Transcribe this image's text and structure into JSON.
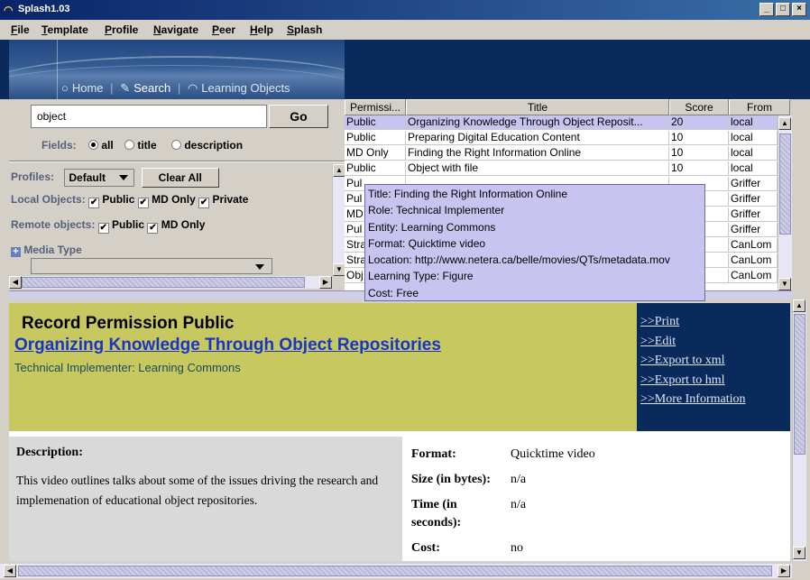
{
  "window": {
    "title": "Splash1.03",
    "minimize": "_",
    "maximize": "□",
    "close": "×"
  },
  "menu": [
    "File",
    "Template",
    "Profile",
    "Navigate",
    "Peer",
    "Help",
    "Splash"
  ],
  "nav": {
    "home": "Home",
    "search": "Search",
    "learning": "Learning Objects",
    "sep": "|"
  },
  "search": {
    "value": "object",
    "go": "Go"
  },
  "fields": {
    "label": "Fields:",
    "all": "all",
    "title": "title",
    "description": "description",
    "selected": "all"
  },
  "filters": {
    "profiles_label": "Profiles:",
    "profile_value": "Default",
    "clear_all": "Clear All",
    "local_label": "Local Objects:",
    "local_public": "Public",
    "local_md": "MD Only",
    "local_private": "Private",
    "remote_label": "Remote objects:",
    "remote_public": "Public",
    "remote_md": "MD Only",
    "media_type": "Media Type",
    "check_mark": "✔"
  },
  "table": {
    "columns": [
      "Permissi...",
      "Title",
      "Score",
      "From"
    ],
    "rows": [
      [
        "Public",
        "Organizing Knowledge Through Object Reposit...",
        "20",
        "local"
      ],
      [
        "Public",
        "Preparing Digital Education Content",
        "10",
        "local"
      ],
      [
        "MD Only",
        "Finding the Right Information Online",
        "10",
        "local"
      ],
      [
        "Public",
        "Object with file",
        "10",
        "local"
      ],
      [
        "Pul",
        "",
        "",
        "Griffer"
      ],
      [
        "Pul",
        "",
        "",
        "Griffer"
      ],
      [
        "MD",
        "",
        "",
        "Griffer"
      ],
      [
        "Pul",
        "",
        "",
        "Griffer"
      ],
      [
        "Stra",
        "",
        "",
        "CanLom"
      ],
      [
        "Stra",
        "",
        "",
        "CanLom"
      ],
      [
        "Obj",
        "",
        "",
        "CanLom"
      ]
    ]
  },
  "tooltip": {
    "lines": [
      "Title: Finding the Right Information Online",
      "Role: Technical Implementer",
      "Entity: Learning Commons",
      "Format: Quicktime video",
      "Location: http://www.netera.ca/belle/movies/QTs/metadata.mov",
      "Learning Type: Figure",
      "Cost: Free"
    ]
  },
  "record": {
    "permission": "Record Permission Public",
    "title": "Organizing Knowledge Through Object Repositories",
    "role": "Technical Implementer",
    "entity": "Learning Commons",
    "actions": [
      ">>Print",
      ">>Edit",
      ">>Export to xml",
      ">>Export to hml",
      ">>More Information"
    ],
    "description_label": "Description:",
    "description": "This video outlines talks about some of the issues driving the research and implemenation of educational object repositories.",
    "props": [
      {
        "k": "Format:",
        "v": "Quicktime video"
      },
      {
        "k": "Size (in bytes):",
        "v": "n/a"
      },
      {
        "k": "Time (in seconds):",
        "v": "n/a"
      },
      {
        "k": "Cost:",
        "v": "no"
      }
    ]
  },
  "colors": {
    "header_bg": "#c8c860",
    "action_bg": "#0b2a5c",
    "link": "#1a33c8",
    "selected_row": "#c8c4f0"
  }
}
